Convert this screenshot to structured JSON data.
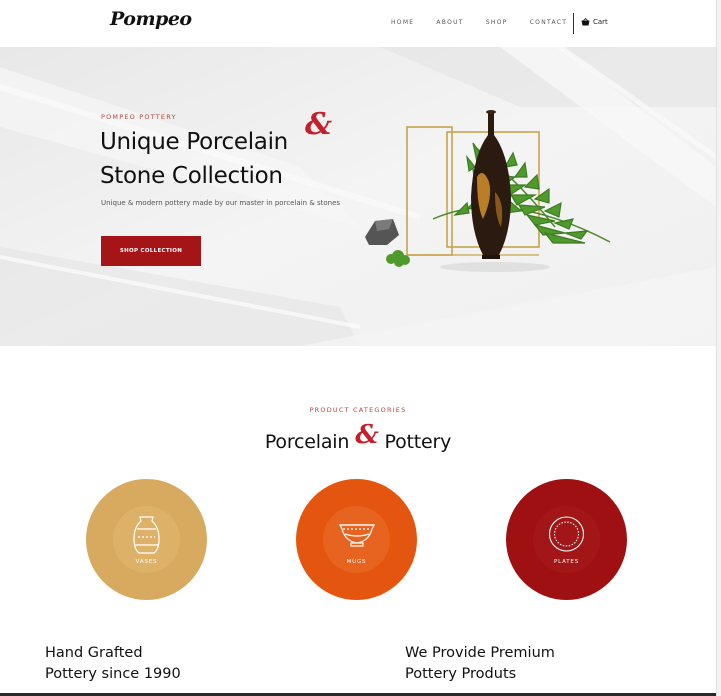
{
  "header": {
    "logo": "Pompeo",
    "nav": [
      "HOME",
      "ABOUT",
      "SHOP",
      "CONTACT"
    ],
    "cart_label": "Cart"
  },
  "hero": {
    "eyebrow": "POMPEO POTTERY",
    "title_line1": "Unique Porcelain",
    "title_line2": "Stone Collection",
    "ampersand": "&",
    "subtitle": "Unique & modern pottery made by our master in porcelain & stones",
    "button": "SHOP COLLECTION"
  },
  "categories": {
    "eyebrow": "PRODUCT CATEGORIES",
    "title_left": "Porcelain",
    "ampersand": "&",
    "title_right": "Pottery",
    "items": [
      {
        "label": "VASES",
        "icon": "vase-icon",
        "color": "#d8aa60"
      },
      {
        "label": "MUGS",
        "icon": "bowl-icon",
        "color": "#e4560f"
      },
      {
        "label": "PLATES",
        "icon": "plate-icon",
        "color": "#9e1011"
      }
    ]
  },
  "features": [
    {
      "line1": "Hand Grafted",
      "line2": "Pottery since 1990"
    },
    {
      "line1": "We Provide Premium",
      "line2": "Pottery Produts"
    }
  ],
  "colors": {
    "accent": "#a51517",
    "ampersand": "#c41f2a",
    "eyebrow": "#b6443d"
  }
}
